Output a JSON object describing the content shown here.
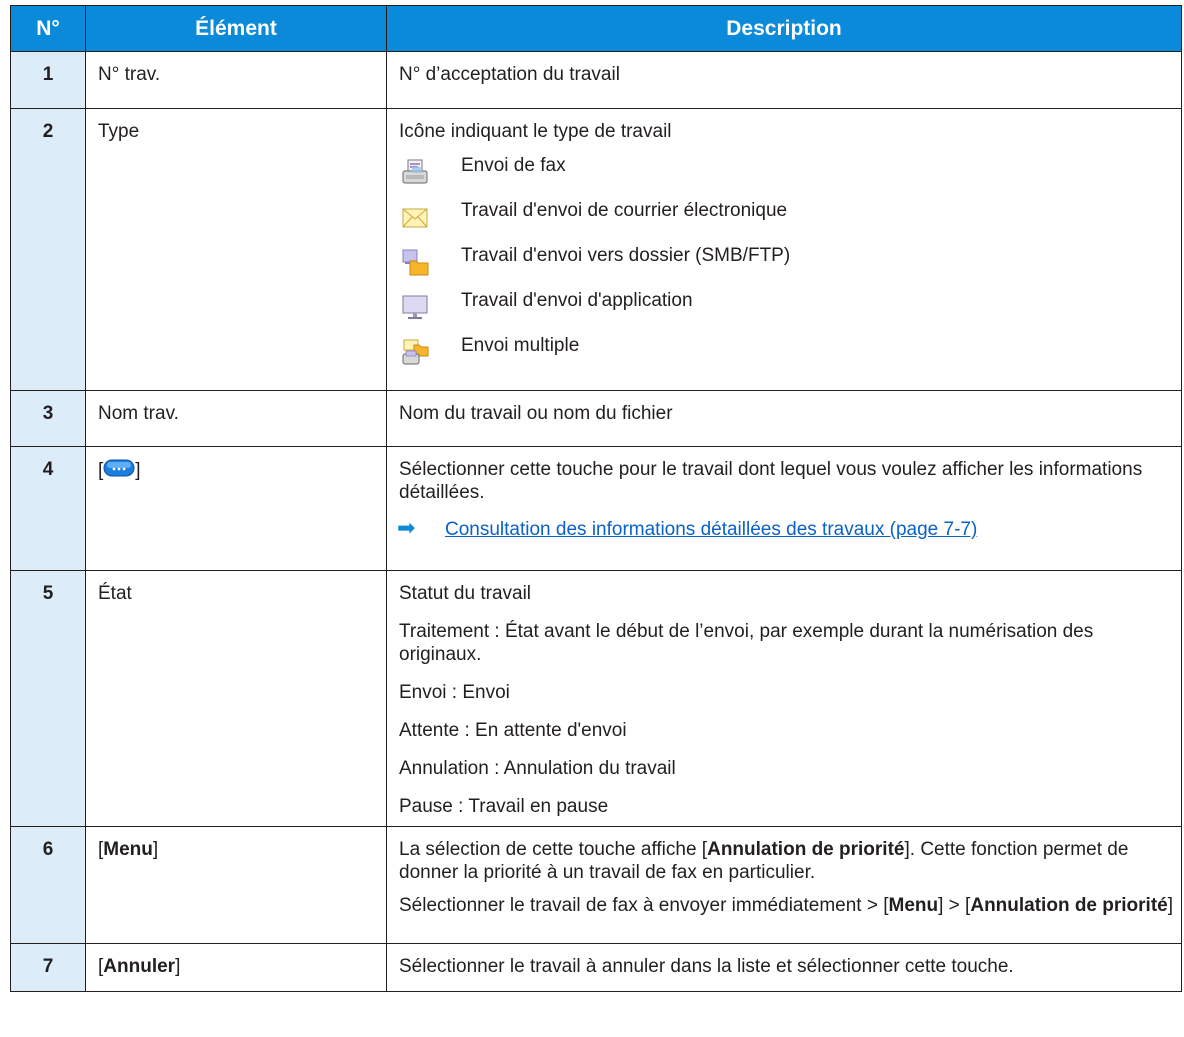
{
  "headers": {
    "num": "N°",
    "element": "Élément",
    "description": "Description"
  },
  "rows": [
    {
      "num": "1",
      "element": "N° trav.",
      "desc": [
        "N° d’acceptation du travail"
      ]
    },
    {
      "num": "2",
      "element": "Type",
      "desc": [
        "Icône indiquant le type de travail"
      ],
      "types": [
        {
          "icon": "fax-send-icon",
          "label": "Envoi de fax"
        },
        {
          "icon": "email-icon",
          "label": "Travail d'envoi de courrier électronique"
        },
        {
          "icon": "folder-icon",
          "label": "Travail d'envoi vers dossier (SMB/FTP)"
        },
        {
          "icon": "application-monitor-icon",
          "label": "Travail d'envoi d'application"
        },
        {
          "icon": "multi-send-icon",
          "label": "Envoi multiple"
        }
      ]
    },
    {
      "num": "3",
      "element": "Nom trav.",
      "desc": [
        "Nom du travail ou nom du fichier"
      ]
    },
    {
      "num": "4",
      "element_open": "[",
      "element_close": "]",
      "desc": [
        "Sélectionner cette touche pour le travail dont lequel vous voulez afficher les informations détaillées."
      ],
      "link": "Consultation des informations détaillées des travaux (page 7-7)"
    },
    {
      "num": "5",
      "element": "État",
      "desc": [
        "Statut du travail",
        "Traitement : État avant le début de l’envoi, par exemple durant la numérisation des originaux.",
        "Envoi : Envoi",
        "Attente : En attente d'envoi",
        "Annulation : Annulation du travail",
        "Pause : Travail en pause"
      ]
    },
    {
      "num": "6",
      "element_open": "[",
      "element_bold": "Menu",
      "element_close": "]",
      "desc_a": "La sélection de cette touche affiche [",
      "desc_a_bold": "Annulation de priorité",
      "desc_a_end": "]. Cette fonction permet de donner la priorité à un travail de fax en particulier.",
      "desc_b": "Sélectionner le travail de fax à envoyer immédiatement > [",
      "desc_b_bold1": "Menu",
      "desc_b_mid": "] > [",
      "desc_b_bold2": "Annulation de priorité",
      "desc_b_end": "]"
    },
    {
      "num": "7",
      "element_open": "[",
      "element_bold": "Annuler",
      "element_close": "]",
      "desc": [
        "Sélectionner le travail à annuler dans la liste et sélectionner cette touche."
      ]
    }
  ],
  "colors": {
    "header_bg": "#0a8ad8",
    "number_bg": "#dcecf8",
    "link": "#0a62c8"
  }
}
